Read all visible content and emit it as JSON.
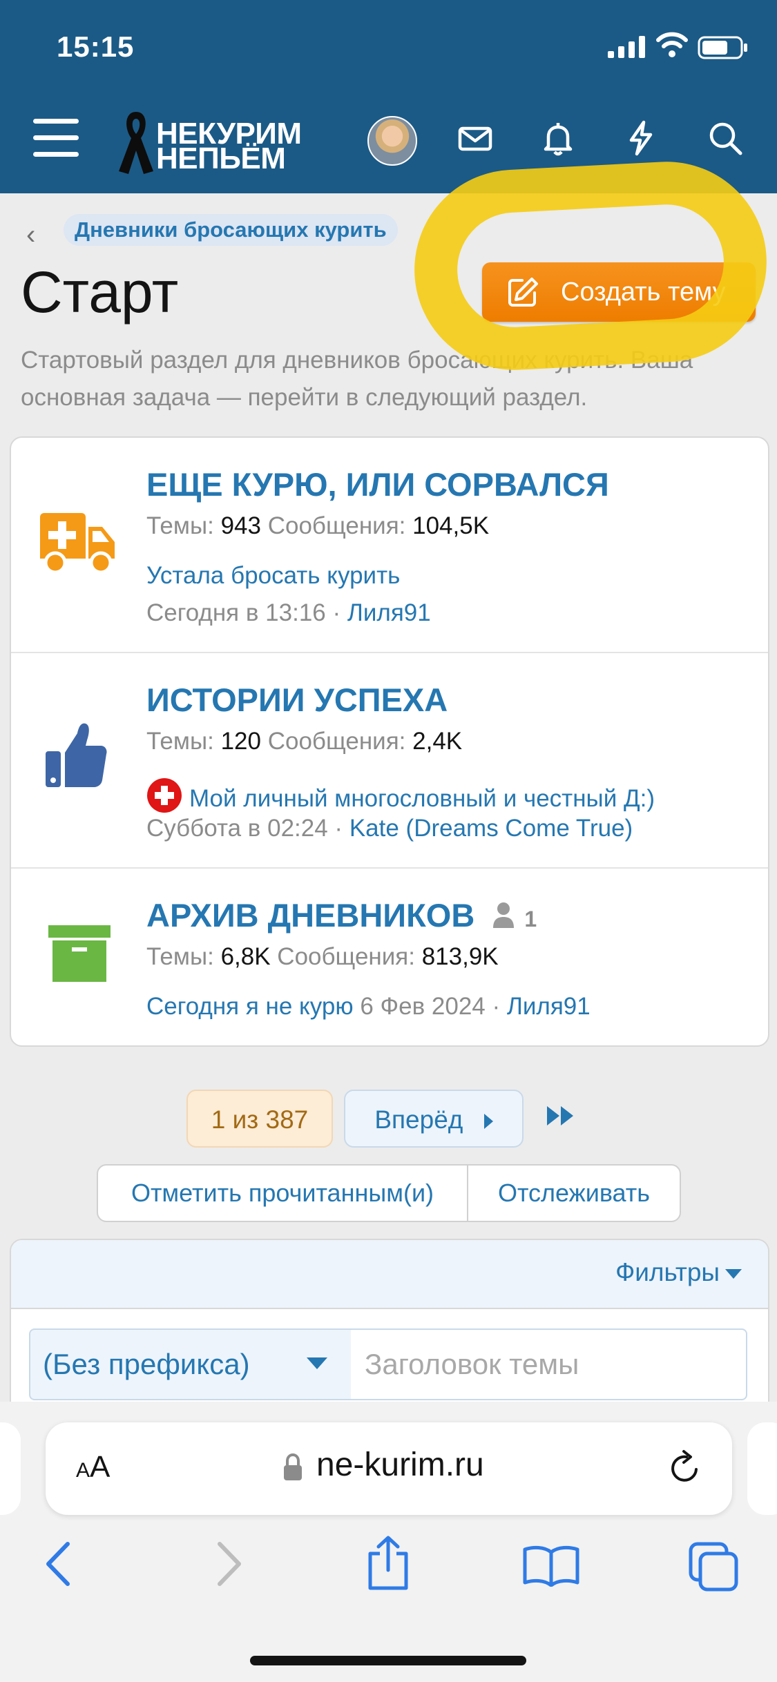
{
  "status_bar": {
    "time": "15:15"
  },
  "header": {
    "logo_line1": "НЕКУРИМ",
    "logo_line2": "НЕПЬЁМ",
    "icons": [
      "menu-icon",
      "avatar",
      "mail-icon",
      "bell-icon",
      "lightning-icon",
      "search-icon"
    ]
  },
  "breadcrumb": {
    "back": "‹",
    "label": "Дневники бросающих курить"
  },
  "page": {
    "title": "Старт",
    "create_button": "Создать тему",
    "description": "Стартовый раздел для дневников бросающих курить. Ваша основная задача — перейти в следующий раздел."
  },
  "forums": [
    {
      "title": "ЕЩЕ КУРЮ, ИЛИ СОРВАЛСЯ",
      "threads_label": "Темы:",
      "threads": "943",
      "posts_label": "Сообщения:",
      "posts": "104,5K",
      "last_thread": "Устала бросать курить",
      "last_date": "Сегодня в 13:16",
      "last_user": "Лиля91",
      "icon": "ambulance-icon"
    },
    {
      "title": "ИСТОРИИ УСПЕХА",
      "threads_label": "Темы:",
      "threads": "120",
      "posts_label": "Сообщения:",
      "posts": "2,4K",
      "last_thread": "Мой личный многословный и честный Д:)",
      "last_date": "Суббота в 02:24",
      "last_user": "Kate (Dreams Come True)",
      "icon": "thumbs-up-icon"
    },
    {
      "title": "АРХИВ ДНЕВНИКОВ",
      "viewers": "1",
      "threads_label": "Темы:",
      "threads": "6,8K",
      "posts_label": "Сообщения:",
      "posts": "813,9K",
      "last_thread": "Сегодня я не курю",
      "last_date": "6 Фев 2024",
      "last_user": "Лиля91",
      "icon": "archive-box-icon"
    }
  ],
  "pagination": {
    "current": "1 из 387",
    "next": "Вперёд"
  },
  "actions": {
    "mark_read": "Отметить прочитанным(и)",
    "watch": "Отслеживать"
  },
  "filters": {
    "label": "Фильтры",
    "prefix": "(Без префикса)",
    "title_placeholder": "Заголовок темы"
  },
  "browser": {
    "aa_small": "A",
    "aa_big": "A",
    "url": "ne-kurim.ru"
  },
  "colors": {
    "header_bg": "#1b5a86",
    "accent_blue": "#2577b1",
    "create_orange": "#ee7d00",
    "highlight_yellow": "#f5cc14"
  }
}
